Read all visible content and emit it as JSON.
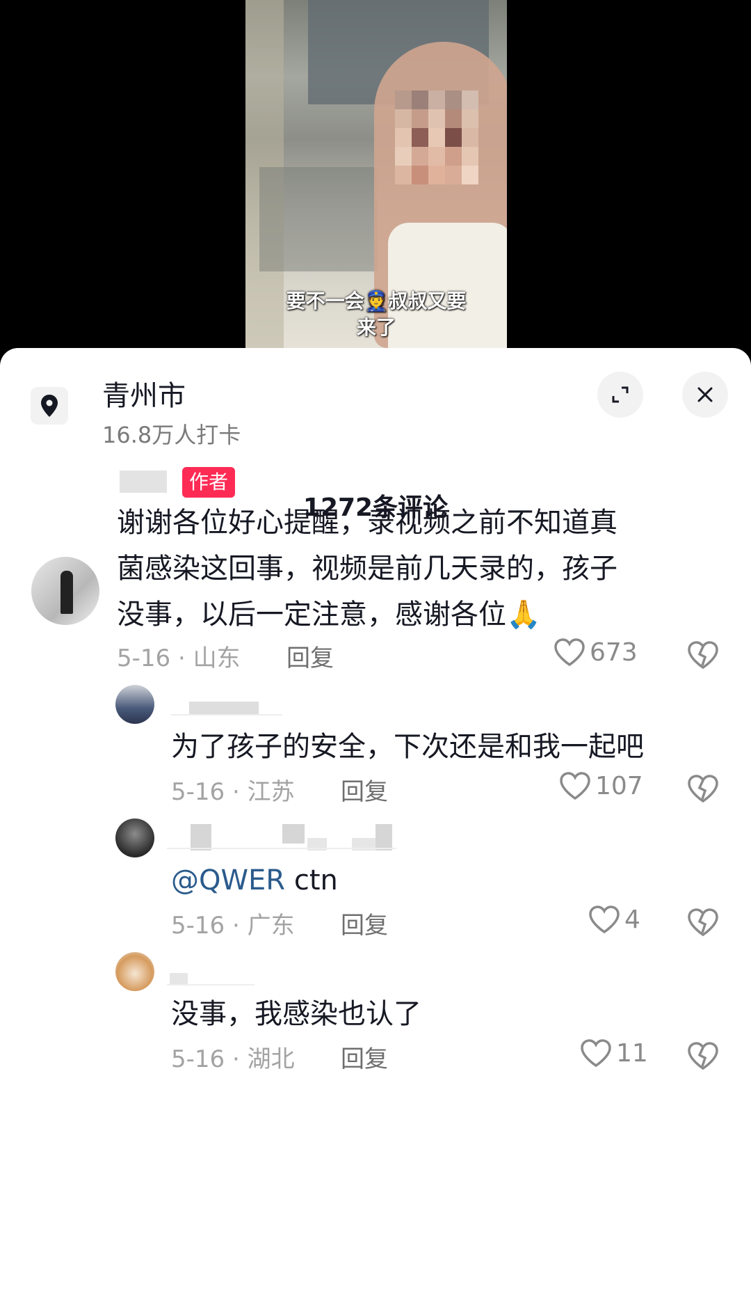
{
  "video": {
    "subtitle_line1": "要不一会👮叔叔又要",
    "subtitle_line2": "来了"
  },
  "location": {
    "name": "青州市",
    "checkins": "16.8万人打卡",
    "icon": "location-pin-icon"
  },
  "header_buttons": {
    "expand_icon": "expand-icon",
    "close_icon": "close-icon"
  },
  "comments_count": "1272条评论",
  "comments": [
    {
      "badge": "作者",
      "text_line1": "谢谢各位好心提醒，录视频之前不知道真",
      "text_line2": "菌感染这回事，视频是前几天录的，孩子",
      "text_line3": "没事，以后一定注意，感谢各位🙏",
      "date_loc": "5-16 · 山东",
      "reply": "回复",
      "likes": "673"
    },
    {
      "text": "为了孩子的安全，下次还是和我一起吧",
      "date_loc": "5-16 · 江苏",
      "reply": "回复",
      "likes": "107"
    },
    {
      "mention": "@QWER",
      "text": " ctn",
      "date_loc": "5-16 · 广东",
      "reply": "回复",
      "likes": "4"
    },
    {
      "text": "没事，我感染也认了",
      "date_loc": "5-16 · 湖北",
      "reply": "回复",
      "likes": "11"
    }
  ],
  "colors": {
    "author_badge": "#fe2c55",
    "mention": "#2b5b8c",
    "text": "#161823",
    "meta": "#a3a3a3"
  }
}
